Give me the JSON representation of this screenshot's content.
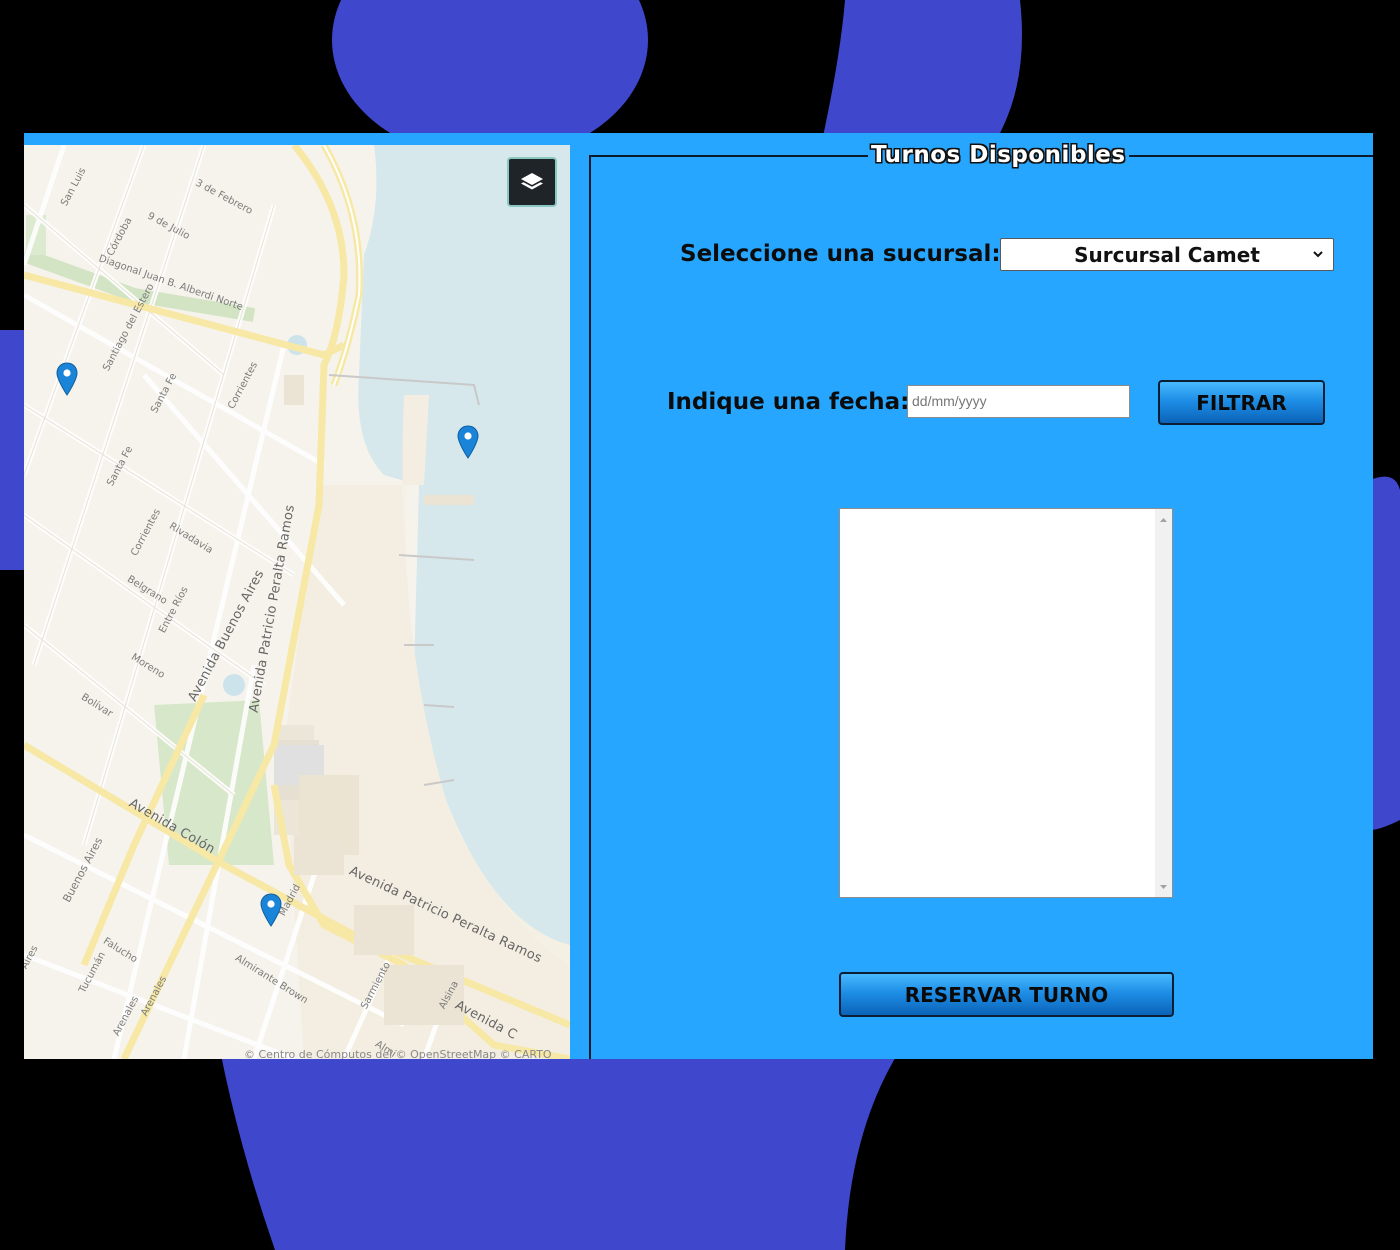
{
  "map": {
    "street_labels": [
      "San Luis",
      "3 de Febrero",
      "Córdoba",
      "9 de Julio",
      "Diagonal Juan B. Alberdi Norte",
      "Santiago del Estero",
      "Santa Fe",
      "Corrientes",
      "Santa Fe",
      "Corrientes",
      "Rivadavia",
      "Belgrano",
      "Entre Ríos",
      "Moreno",
      "Bolívar",
      "Buenos Aires",
      "Falucho",
      "Tucumán",
      "Almirante Brown",
      "Sarmiento",
      "Alsina",
      "Arenales",
      "Arenales",
      "Aires",
      "Madrid",
      "Almi"
    ],
    "avenue_labels": [
      "Avenida Buenos Aires",
      "Avenida Patricio Peralta Ramos",
      "Avenida Patricio Peralta Ramos",
      "Avenida Colón",
      "Avenida C"
    ],
    "layers_icon": "layers-icon",
    "marker_icon": "map-marker-icon",
    "attribution": "© Centro de Cómputos del © OpenStreetMap © CARTO"
  },
  "panel": {
    "title": "Turnos Disponibles",
    "branch_label": "Seleccione una sucursal:",
    "branch_selected": "Surcursal Camet",
    "date_label": "Indique una fecha:",
    "date_placeholder": "dd/mm/yyyy",
    "filter_button": "FILTRAR",
    "reserve_button": "RESERVAR TURNO"
  },
  "colors": {
    "page_bg": "#000000",
    "blob": "#3f47cc",
    "panel_bg": "#26a6fe",
    "button_gradient_top": "#47b9ff",
    "button_gradient_bottom": "#0b63b8",
    "marker": "#1a84d8"
  }
}
